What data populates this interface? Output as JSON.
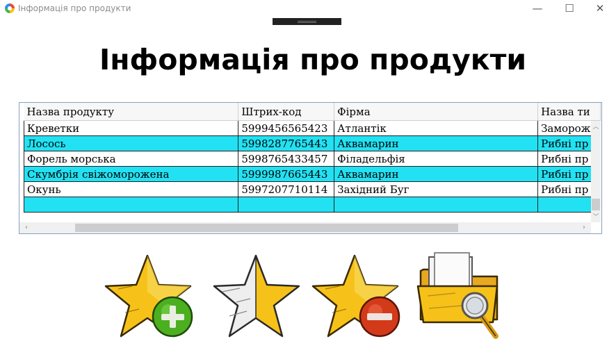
{
  "window": {
    "title": "Інформація про продукти",
    "minimize_glyph": "—",
    "maximize_glyph": "☐",
    "close_glyph": "✕"
  },
  "heading": "Інформація про продукти",
  "table": {
    "columns": [
      "Назва продукту",
      "Штрих-код",
      "Фірма",
      "Назва ти"
    ],
    "rows": [
      [
        "Креветки",
        "5999456565423",
        "Атлантік",
        "Замороже"
      ],
      [
        "Лосось",
        "5998287765443",
        "Аквамарин",
        "Рибні пр"
      ],
      [
        "Форель морська",
        "5998765433457",
        "Філадельфія",
        "Рибні пр"
      ],
      [
        "Скумбрія свіжоморожена",
        "5999987665443",
        "Аквамарин",
        "Рибні пр"
      ],
      [
        "Окунь",
        "5997207710114",
        "Західний Буг",
        "Рибні пр"
      ]
    ]
  },
  "toolbar": {
    "buttons": [
      {
        "icon": "star-add-icon"
      },
      {
        "icon": "star-edit-icon"
      },
      {
        "icon": "star-remove-icon"
      },
      {
        "icon": "folder-search-icon"
      }
    ]
  },
  "colors": {
    "row_highlight": "#22e1f2",
    "star_yellow": "#f6c21a",
    "green_badge": "#4caf1f",
    "red_badge": "#d23a1a"
  }
}
